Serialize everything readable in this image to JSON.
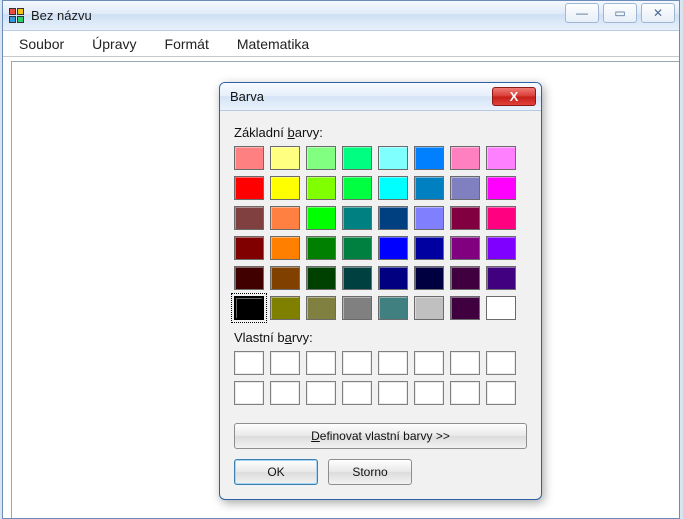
{
  "window": {
    "title": "Bez názvu",
    "controls": {
      "min": "—",
      "max": "▭",
      "close": "✕"
    }
  },
  "menu": {
    "items": [
      "Soubor",
      "Úpravy",
      "Formát",
      "Matematika"
    ]
  },
  "dialog": {
    "title": "Barva",
    "close": "X",
    "basic_label_pre": "Základní ",
    "basic_label_u": "b",
    "basic_label_post": "arvy:",
    "custom_label_pre": "Vlastní b",
    "custom_label_u": "a",
    "custom_label_post": "rvy:",
    "define_pre": "",
    "define_u": "D",
    "define_post": "efinovat vlastní barvy >>",
    "ok": "OK",
    "cancel": "Storno",
    "basic_colors": [
      [
        "#ff8080",
        "#ffff80",
        "#80ff80",
        "#00ff80",
        "#80ffff",
        "#0080ff",
        "#ff80c0",
        "#ff80ff"
      ],
      [
        "#ff0000",
        "#ffff00",
        "#80ff00",
        "#00ff40",
        "#00ffff",
        "#0080c0",
        "#8080c0",
        "#ff00ff"
      ],
      [
        "#804040",
        "#ff8040",
        "#00ff00",
        "#008080",
        "#004080",
        "#8080ff",
        "#800040",
        "#ff0080"
      ],
      [
        "#800000",
        "#ff8000",
        "#008000",
        "#008040",
        "#0000ff",
        "#0000a0",
        "#800080",
        "#8000ff"
      ],
      [
        "#400000",
        "#804000",
        "#004000",
        "#004040",
        "#000080",
        "#000040",
        "#400040",
        "#400080"
      ],
      [
        "#000000",
        "#808000",
        "#808040",
        "#808080",
        "#408080",
        "#c0c0c0",
        "#400040",
        "#ffffff"
      ]
    ],
    "selected_row": 5,
    "selected_col": 0,
    "custom_slots": 16
  }
}
